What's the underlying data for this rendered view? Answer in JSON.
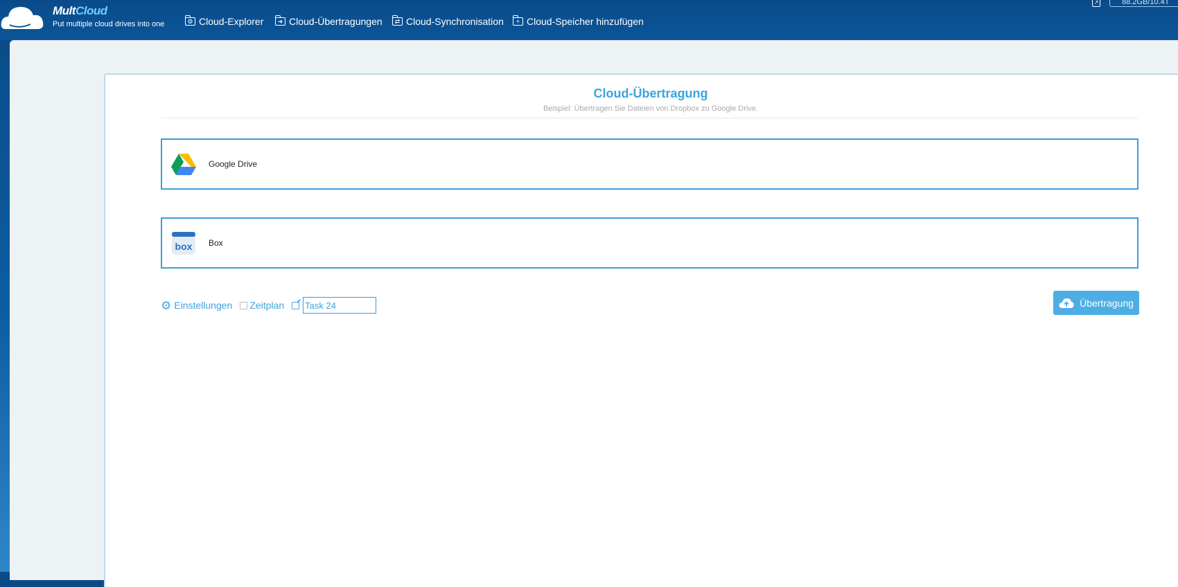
{
  "brand": {
    "name_part1": "Mult",
    "name_part2": "Cloud",
    "tagline": "Put multiple cloud drives into one"
  },
  "nav": [
    {
      "label": "Cloud-Explorer",
      "icon": "folder-settings-icon"
    },
    {
      "label": "Cloud-Übertragungen",
      "icon": "folder-transfer-icon"
    },
    {
      "label": "Cloud-Synchronisation",
      "icon": "folder-sync-icon"
    },
    {
      "label": "Cloud-Speicher hinzufügen",
      "icon": "folder-add-icon"
    }
  ],
  "storage": {
    "text": "88.2GB/10.4T"
  },
  "panel": {
    "title": "Cloud-Übertragung",
    "subtitle": "Beispiel: Übertragen Sie Dateien von Dropbox zu Google Drive.",
    "source": {
      "label": "Google Drive",
      "icon": "google-drive-icon"
    },
    "target": {
      "label": "Box",
      "icon": "box-icon"
    },
    "options": {
      "settings_label": "Einstellungen",
      "schedule_label": "Zeitplan",
      "schedule_checked": false,
      "task_name": "Task 24"
    },
    "transfer_button": "Übertragung"
  },
  "colors": {
    "accent": "#3aa3dd",
    "header": "#0b5598",
    "border": "#3a9ed6"
  }
}
